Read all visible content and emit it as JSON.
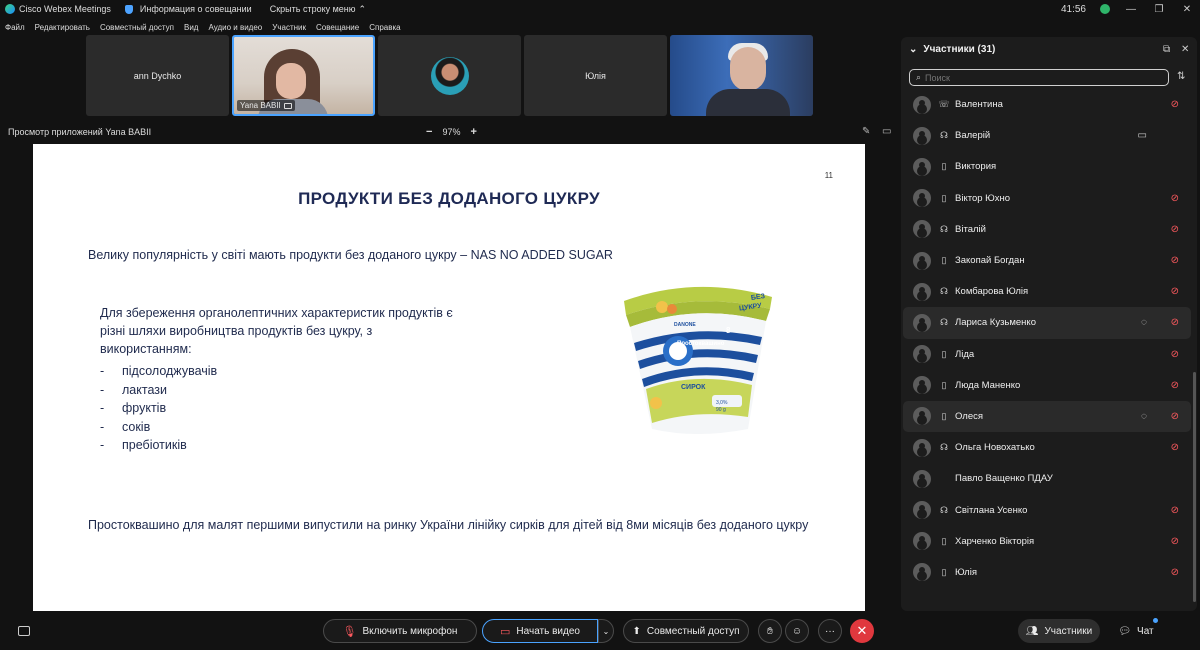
{
  "titlebar": {
    "app_name": "Cisco Webex Meetings",
    "meeting_info": "Информация о совещании",
    "hide_menu": "Скрыть строку меню",
    "time": "41:56"
  },
  "menu": [
    "Файл",
    "Редактировать",
    "Совместный доступ",
    "Вид",
    "Аудио и видео",
    "Участник",
    "Совещание",
    "Справка"
  ],
  "tiles": [
    {
      "name": "ann Dychko"
    },
    {
      "name": "Yana BABII"
    },
    {
      "name": ""
    },
    {
      "name": "Юлія"
    },
    {
      "name": ""
    }
  ],
  "viewer": {
    "title": "Просмотр приложений Yana BABII",
    "zoom_minus": "−",
    "zoom": "97%",
    "zoom_plus": "+"
  },
  "slide": {
    "page_number": "11",
    "title": "ПРОДУКТИ БЕЗ ДОДАНОГО ЦУКРУ",
    "intro": "Велику популярність у світі мають продукти без доданого цукру – NAS NO ADDED SUGAR",
    "paragraph": "Для збереження органолептичних характеристик продуктів є різні шляхи виробництва продуктів без цукру, з використанням:",
    "bullets": [
      "підсолоджувачів",
      "лактази",
      "фруктів",
      "соків",
      "пребіотиків"
    ],
    "footer": "Простоквашино для малят першими випустили на ринку України лінійку сирків для дітей від 8ми місяців без доданого цукру",
    "cup": {
      "brand": "Простоквашино",
      "label_bez": "БЕЗ",
      "label_cukru": "ЦУКРУ",
      "product": "СИРОК",
      "age": "8",
      "maker": "DANONE",
      "fat": "3,0%",
      "weight": "90 g"
    }
  },
  "toolbar": {
    "mic": "Включить микрофон",
    "video": "Начать видео",
    "share": "Совместный доступ",
    "more": "···",
    "participants": "Участники",
    "chat": "Чат"
  },
  "panel": {
    "title": "Участники (31)",
    "search_placeholder": "Поиск",
    "participants": [
      {
        "name": "Валентина",
        "device": "phone-icon",
        "extra": "",
        "muted": true,
        "highlight": false
      },
      {
        "name": "Валерій",
        "device": "headset-icon",
        "extra": "video-icon",
        "muted": false,
        "highlight": false
      },
      {
        "name": "Виктория",
        "device": "mobile-icon",
        "extra": "",
        "muted": false,
        "highlight": false
      },
      {
        "name": "Віктор Юхно",
        "device": "mobile-icon",
        "extra": "",
        "muted": true,
        "highlight": false
      },
      {
        "name": "Віталій",
        "device": "headset-icon",
        "extra": "",
        "muted": true,
        "highlight": false
      },
      {
        "name": "Закопай Богдан",
        "device": "mobile-icon",
        "extra": "",
        "muted": true,
        "highlight": false
      },
      {
        "name": "Комбарова Юлія",
        "device": "headset-icon",
        "extra": "",
        "muted": true,
        "highlight": false
      },
      {
        "name": "Лариса Кузьменко",
        "device": "headset-icon",
        "extra": "chat-icon",
        "muted": true,
        "highlight": true
      },
      {
        "name": "Ліда",
        "device": "mobile-icon",
        "extra": "",
        "muted": true,
        "highlight": false
      },
      {
        "name": "Люда Маненко",
        "device": "mobile-icon",
        "extra": "",
        "muted": true,
        "highlight": false
      },
      {
        "name": "Олеся",
        "device": "mobile-icon",
        "extra": "chat-icon",
        "muted": true,
        "highlight": true
      },
      {
        "name": "Ольга Новохатько",
        "device": "headset-icon",
        "extra": "",
        "muted": true,
        "highlight": false
      },
      {
        "name": "Павло Ващенко ПДАУ",
        "device": "",
        "extra": "",
        "muted": false,
        "highlight": false
      },
      {
        "name": "Світлана Усенко",
        "device": "headset-icon",
        "extra": "",
        "muted": true,
        "highlight": false
      },
      {
        "name": "Харченко Вікторія",
        "device": "mobile-icon",
        "extra": "",
        "muted": true,
        "highlight": false
      },
      {
        "name": "Юлія",
        "device": "mobile-icon",
        "extra": "",
        "muted": true,
        "highlight": false
      }
    ]
  },
  "colors": {
    "accent": "#4aa3ff",
    "mute_red": "#ff5a5f",
    "end_red": "#e0383e",
    "slide_text": "#1f2a4d"
  }
}
